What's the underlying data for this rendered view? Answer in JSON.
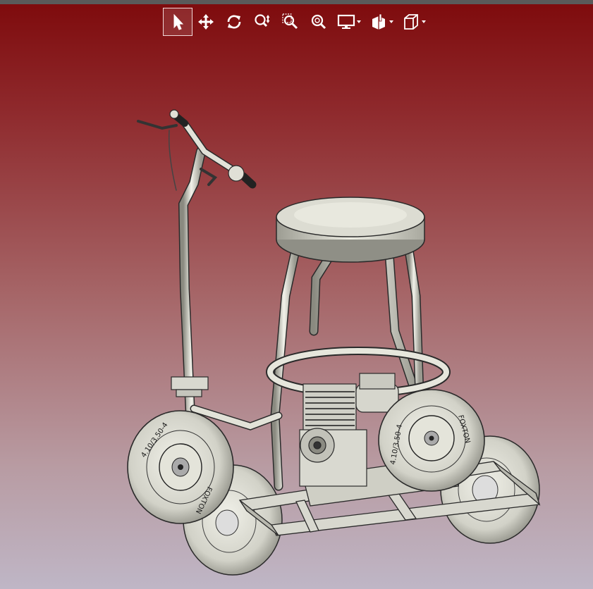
{
  "toolbar": {
    "tools": [
      {
        "id": "select",
        "icon": "select-arrow-icon",
        "active": true
      },
      {
        "id": "pan",
        "icon": "pan-move-icon"
      },
      {
        "id": "rotate",
        "icon": "rotate-icon"
      },
      {
        "id": "zoom-in-out",
        "icon": "zoom-in-out-icon"
      },
      {
        "id": "zoom-window",
        "icon": "zoom-window-icon"
      },
      {
        "id": "zoom-fit",
        "icon": "zoom-fit-icon"
      },
      {
        "id": "display-style",
        "icon": "display-monitor-icon",
        "dropdown": true
      },
      {
        "id": "section-view",
        "icon": "section-view-icon",
        "dropdown": true
      },
      {
        "id": "view-orientation",
        "icon": "view-cube-icon",
        "dropdown": true
      }
    ]
  },
  "model": {
    "tire_brand": "FOXTON",
    "tire_size": "4.10/3.50-4"
  },
  "colors": {
    "bg_top": "#7e0a0c",
    "bg_bottom": "#bfb6c6",
    "toolbar_icon": "#ffffff"
  }
}
